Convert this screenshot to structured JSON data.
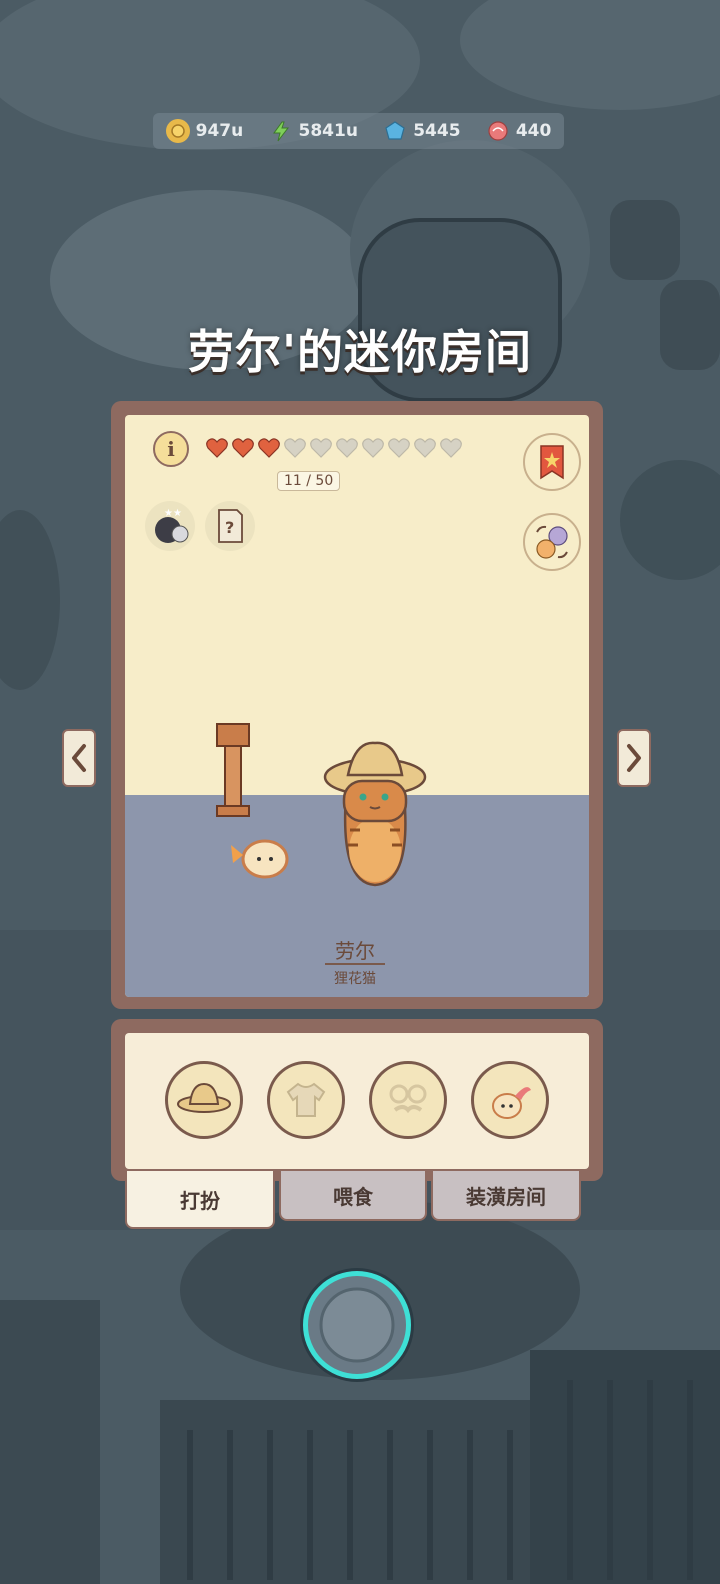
{
  "currency": {
    "coins": "947u",
    "energy": "5841u",
    "gems": "5445",
    "candy": "440"
  },
  "room": {
    "title": "劳尔'的迷你房间",
    "info_label": "i",
    "hearts_filled": 3,
    "hearts_total": 10,
    "progress": "11 / 50",
    "cat_name": "劳尔",
    "cat_breed": "狸花猫"
  },
  "tabs": [
    {
      "label": "打扮",
      "active": true
    },
    {
      "label": "喂食",
      "active": false
    },
    {
      "label": "装潢房间",
      "active": false
    }
  ],
  "slots": [
    {
      "icon": "straw-hat-icon"
    },
    {
      "icon": "shirt-icon"
    },
    {
      "icon": "glasses-mustache-icon"
    },
    {
      "icon": "fish-pet-icon"
    }
  ],
  "colors": {
    "heart_filled": "#e0623f",
    "heart_empty": "#d6d2c4",
    "accent_ring": "#3ee0d6",
    "frame": "#8e6a60"
  }
}
